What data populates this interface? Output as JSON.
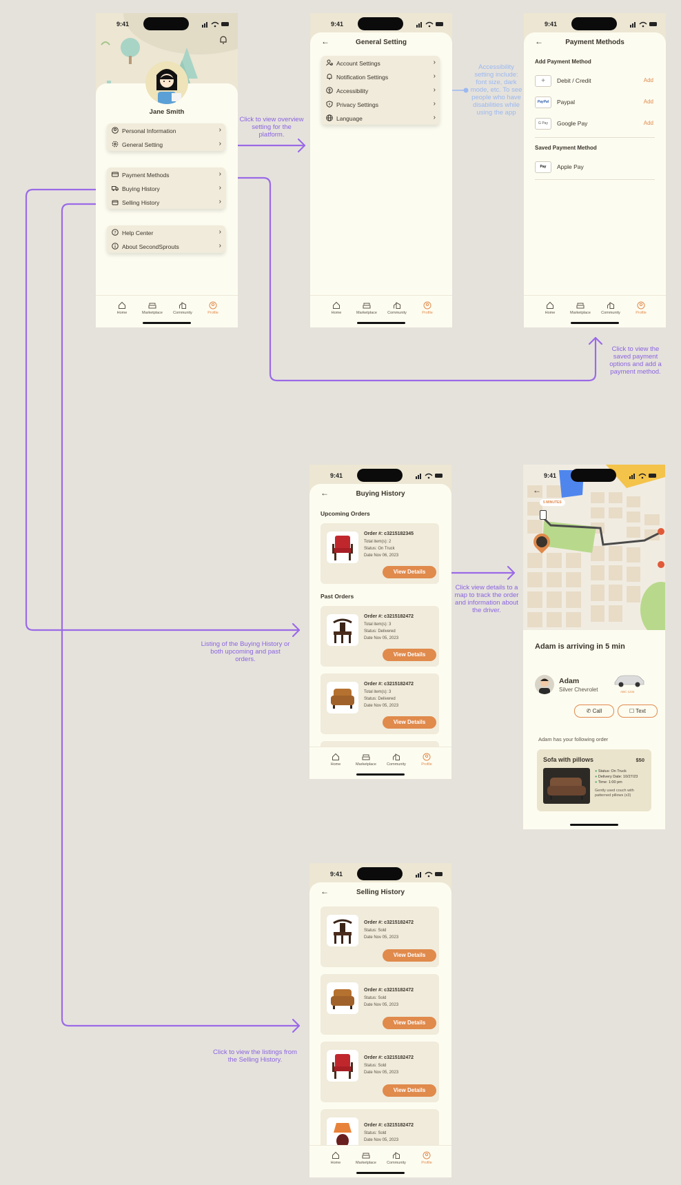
{
  "status": {
    "time": "9:41"
  },
  "nav": {
    "home": "Home",
    "marketplace": "Marketplace",
    "community": "Community",
    "profile": "Profile"
  },
  "profile": {
    "name": "Jane Smith",
    "group1": [
      "Personal Information",
      "General Setting"
    ],
    "group2": [
      "Payment Methods",
      "Buying History",
      "Selling History"
    ],
    "group3": [
      "Help Center",
      "About SecondSprouts"
    ]
  },
  "general": {
    "title": "General Setting",
    "items": [
      "Account Settings",
      "Notification Settings",
      "Accessibility",
      "Privacy Settings",
      "Language"
    ]
  },
  "payment": {
    "title": "Payment Methods",
    "add_section": "Add Payment Method",
    "methods": [
      {
        "name": "Debit / Credit",
        "action": "Add"
      },
      {
        "name": "Paypal",
        "action": "Add"
      },
      {
        "name": "Google Pay",
        "action": "Add"
      }
    ],
    "saved_section": "Saved Payment Method",
    "saved": [
      "Apple Pay"
    ],
    "logos": {
      "paypal": "PayPal",
      "gpay": "G Pay",
      "applepay": "Pay"
    }
  },
  "buying": {
    "title": "Buying History",
    "upcoming": "Upcoming Orders",
    "past": "Past Orders",
    "orders": [
      {
        "order": "Order #: c3215182345",
        "items": "Total item(s): 2",
        "status": "Status: On Truck",
        "date": "Date Nov 06, 2023"
      },
      {
        "order": "Order #: c3215182472",
        "items": "Total item(s): 3",
        "status": "Status: Delivered",
        "date": "Date Nov 05, 2023"
      },
      {
        "order": "Order #: c3215182472",
        "items": "Total item(s): 3",
        "status": "Status: Delivered",
        "date": "Date Nov 05, 2023"
      }
    ],
    "view_details": "View Details"
  },
  "tracking": {
    "eta_badge": "5 MINUTES",
    "arriving": "Adam is arriving in 5 min",
    "driver": "Adam",
    "car": "Silver Chevrolet",
    "plate": "ABC 1234",
    "call": "Call",
    "text": "Text",
    "following": "Adam has your following order",
    "item": "Sofa with pillows",
    "price": "$50",
    "status": "Status: On Truck",
    "delivery": "Delivery Date: 10/27/23",
    "time": "Time: 1:00 pm",
    "desc": "Gently used couch with patterned pillows (x3)"
  },
  "selling": {
    "title": "Selling History",
    "orders": [
      {
        "order": "Order #: c3215182472",
        "status": "Status: Sold",
        "date": "Date Nov 05, 2023"
      },
      {
        "order": "Order #: c3215182472",
        "status": "Status: Sold",
        "date": "Date Nov 05, 2023"
      },
      {
        "order": "Order #: c3215182472",
        "status": "Status: Sold",
        "date": "Date Nov 05, 2023"
      },
      {
        "order": "Order #: c3215182472",
        "status": "Status: Sold",
        "date": "Date Nov 05, 2023"
      }
    ],
    "view_details": "View Details"
  },
  "annotations": {
    "general": "Click to view overview setting for the platform.",
    "accessibility": "Accessibility setting include: font size, dark mode, etc. To see people who have disabilities while using the app",
    "payment": "Click to view the saved payment options and add a payment method.",
    "view_details": "Click view details to a map to track the order and information about the driver.",
    "buying": "Listing of the Buying History or both upcoming and past orders.",
    "selling": "Click to view the listings from the Selling History."
  },
  "colors": {
    "accent": "#e08a4c",
    "flow": "#9a6ae6",
    "bg": "#e5e2dc",
    "card": "#f0ebda",
    "phone": "#fdfcf0"
  }
}
